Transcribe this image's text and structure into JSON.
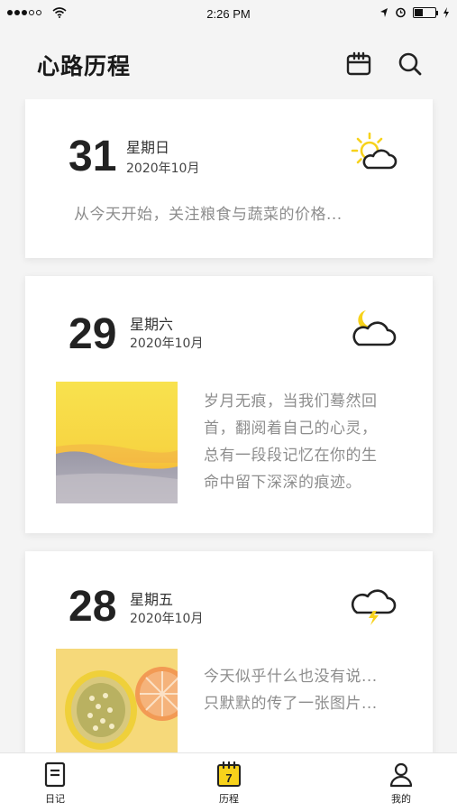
{
  "status_bar": {
    "time": "2:26 PM"
  },
  "header": {
    "title": "心路历程"
  },
  "icons": {
    "calendar": "calendar-icon",
    "search": "search-icon",
    "sun_cloud": "partly-sunny-icon",
    "moon_cloud": "partly-cloudy-night-icon",
    "thunder": "thunderstorm-icon",
    "diary": "diary-icon",
    "journey": "journey-calendar-icon",
    "profile": "profile-icon"
  },
  "colors": {
    "accent": "#f7d21b",
    "text_muted": "#8d8d8d"
  },
  "entries": [
    {
      "day": "31",
      "weekday": "星期日",
      "ym": "2020年10月",
      "weather": "partly-sunny",
      "excerpt": "从今天开始，关注粮食与蔬菜的价格..."
    },
    {
      "day": "29",
      "weekday": "星期六",
      "ym": "2020年10月",
      "weather": "partly-cloudy-night",
      "excerpt_lines": [
        "岁月无痕，当我们蓦然回",
        "首，翻阅着自己的心灵，",
        "总有一段段记忆在你的生",
        "命中留下深深的痕迹。"
      ]
    },
    {
      "day": "28",
      "weekday": "星期五",
      "ym": "2020年10月",
      "weather": "thunderstorm",
      "excerpt_lines": [
        "今天似乎什么也没有说...",
        "只默默的传了一张图片..."
      ]
    }
  ],
  "tabs": [
    {
      "label": "日记",
      "active": false
    },
    {
      "label": "历程",
      "active": true,
      "badge": "7"
    },
    {
      "label": "我的",
      "active": false
    }
  ]
}
